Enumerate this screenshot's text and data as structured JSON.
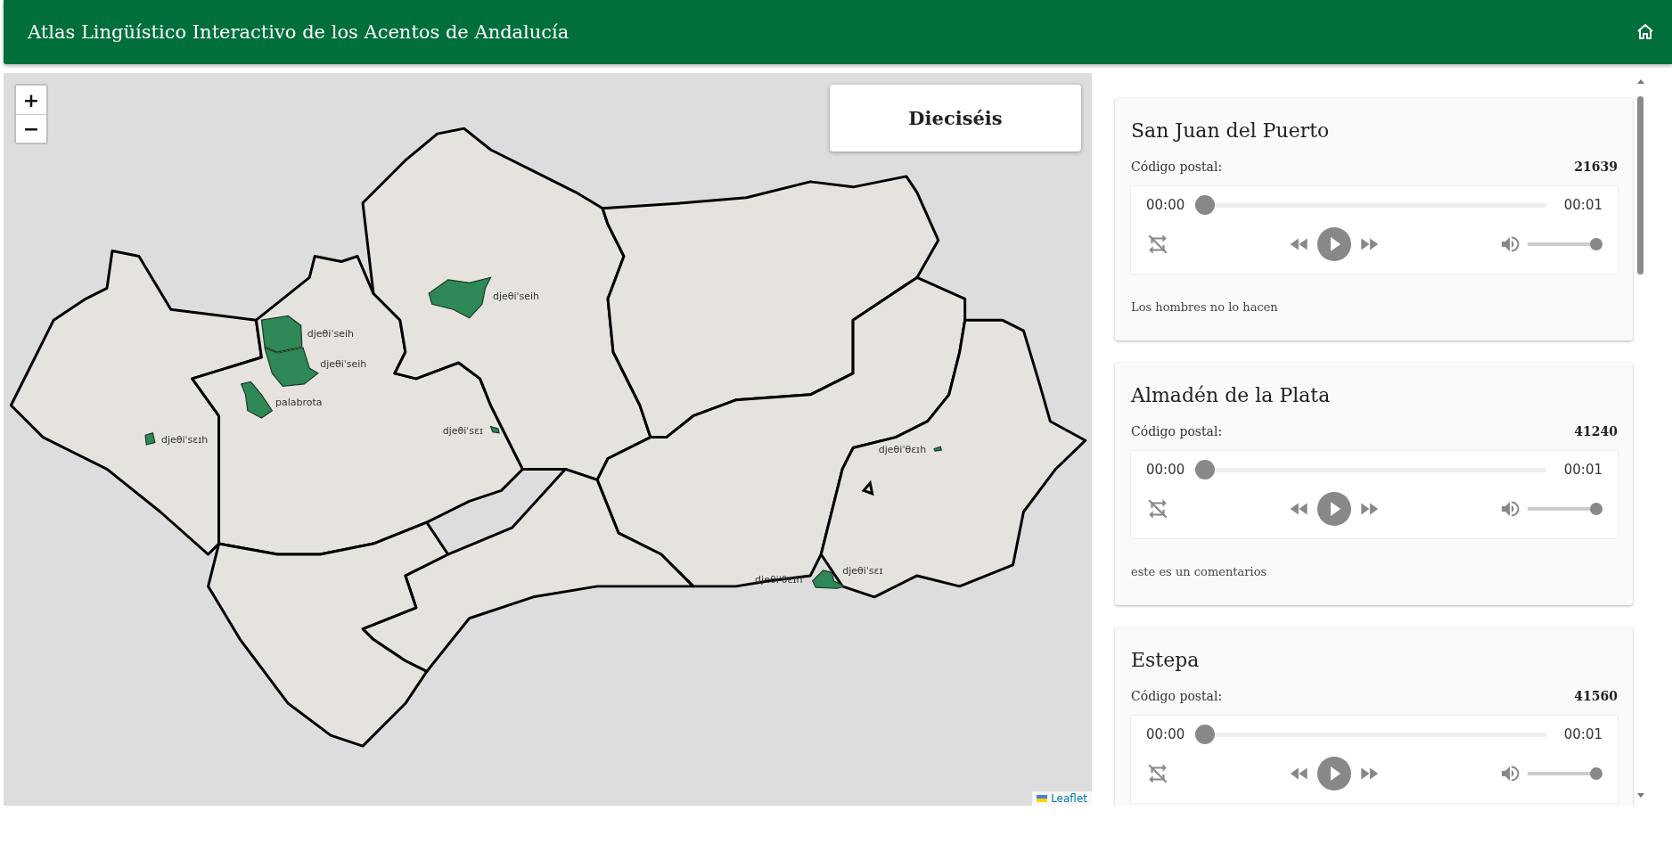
{
  "header": {
    "title": "Atlas Lingüístico Interactivo de los Acentos de Andalucía"
  },
  "map": {
    "zoom_in": "+",
    "zoom_out": "−",
    "word": "Dieciséis",
    "attribution": "Leaflet",
    "labels": [
      {
        "text": "djeθiˈseih"
      },
      {
        "text": "djeθiˈseih"
      },
      {
        "text": "djeθiˈseih"
      },
      {
        "text": "palabrota"
      },
      {
        "text": "djeθiˈsɛɪh"
      },
      {
        "text": "djeθiˈsɛɪ"
      },
      {
        "text": "djeθiˈθɛɪh"
      },
      {
        "text": "djeθiˈθɛɪh"
      },
      {
        "text": "djeθiˈsɛɪ"
      }
    ]
  },
  "locations": [
    {
      "name": "San Juan del Puerto",
      "postal_label": "Código postal:",
      "postal_code": "21639",
      "player": {
        "current_time": "00:00",
        "duration": "00:01",
        "seek": {
          "level": 0
        },
        "volume": {
          "level": 1
        }
      },
      "comment": "Los hombres no lo hacen"
    },
    {
      "name": "Almadén de la Plata",
      "postal_label": "Código postal:",
      "postal_code": "41240",
      "player": {
        "current_time": "00:00",
        "duration": "00:01",
        "seek": {
          "level": 0
        },
        "volume": {
          "level": 1
        }
      },
      "comment": "este es un comentarios"
    },
    {
      "name": "Estepa",
      "postal_label": "Código postal:",
      "postal_code": "41560",
      "player": {
        "current_time": "00:00",
        "duration": "00:01",
        "seek": {
          "level": 0
        },
        "volume": {
          "level": 1
        }
      }
    }
  ]
}
